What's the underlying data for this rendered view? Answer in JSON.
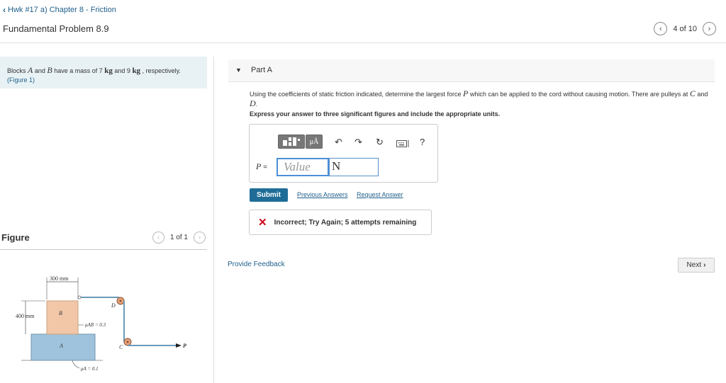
{
  "header": {
    "back_label": "Hwk #17 a) Chapter 8 - Friction",
    "page_title": "Fundamental Problem 8.9",
    "pager_text": "4 of 10"
  },
  "problem": {
    "text_1": "Blocks ",
    "var_a": "A",
    "text_2": " and ",
    "var_b": "B",
    "text_3": " have a mass of 7 ",
    "unit_1": "kg",
    "text_4": " and 9 ",
    "unit_2": "kg",
    "text_5": " , respectively.",
    "figure_ref": "(Figure 1)"
  },
  "figure": {
    "label": "Figure",
    "pager_text": "1 of 1",
    "dim_width": "300 mm",
    "dim_height": "400 mm",
    "label_b": "B",
    "label_a": "A",
    "label_c": "C",
    "label_d": "D",
    "label_p": "P",
    "mu_ab": "μAB = 0.3",
    "mu_a": "μA = 0.1"
  },
  "part": {
    "title": "Part A",
    "question_1": "Using the coefficients of static friction indicated, determine the largest force ",
    "question_var": "P",
    "question_2": " which can be applied to the cord without causing motion. There are pulleys at ",
    "question_c": "C",
    "question_and": " and ",
    "question_d": "D",
    "question_end": ".",
    "instruction": "Express your answer to three significant figures and include the appropriate units."
  },
  "answer": {
    "p_var": "P",
    "p_eq": " =",
    "value_placeholder": "Value",
    "unit_value": "N",
    "tool_mu": "μÅ",
    "tool_help": "?"
  },
  "actions": {
    "submit": "Submit",
    "previous_answers": "Previous Answers",
    "request_answer": "Request Answer"
  },
  "feedback": {
    "status_text": "Incorrect; Try Again; 5 attempts remaining"
  },
  "footer": {
    "provide_feedback": "Provide Feedback",
    "next": "Next"
  }
}
